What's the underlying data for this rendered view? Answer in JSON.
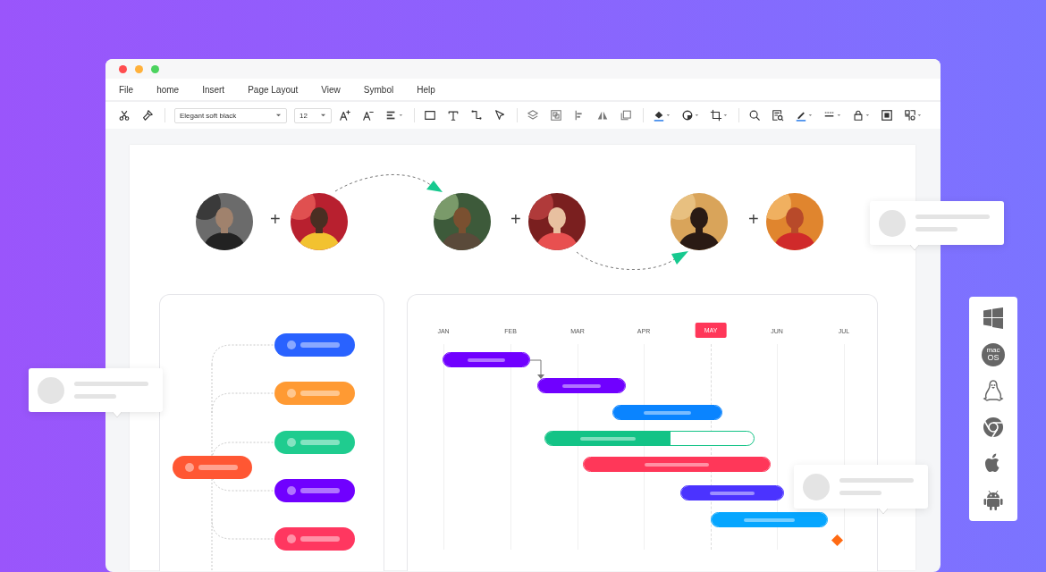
{
  "window": {
    "controls": [
      {
        "kind": "close"
      },
      {
        "kind": "minimize"
      },
      {
        "kind": "maximize"
      }
    ]
  },
  "menu": [
    "File",
    "home",
    "Insert",
    "Page Layout",
    "View",
    "Symbol",
    "Help"
  ],
  "toolbar": {
    "font": "Elegant soft black",
    "size": "12"
  },
  "photo_row": {
    "separators": [
      "+",
      "+",
      "+"
    ]
  },
  "mind_map": {
    "root": {
      "color": "#ff5733"
    },
    "branches": [
      {
        "color": "#2962ff"
      },
      {
        "color": "#ff9a33"
      },
      {
        "color": "#1fcc8f"
      },
      {
        "color": "#7000ff"
      },
      {
        "color": "#ff3760"
      }
    ]
  },
  "gantt": {
    "months": [
      {
        "label": "JAN",
        "selected": false
      },
      {
        "label": "FEB",
        "selected": false
      },
      {
        "label": "MAR",
        "selected": false
      },
      {
        "label": "APR",
        "selected": false
      },
      {
        "label": "MAY",
        "selected": true
      },
      {
        "label": "JUN",
        "selected": false
      },
      {
        "label": "JUL",
        "selected": false
      }
    ],
    "bars": [
      {
        "color": "#7000ff",
        "level": 1
      },
      {
        "color": "#7000ff",
        "level": 1
      },
      {
        "color": "#0a84ff",
        "level": 1
      },
      {
        "color": "#13c386",
        "level": 0.6
      },
      {
        "color": "#ff3759",
        "level": 1
      },
      {
        "color": "#4b33ff",
        "level": 1
      },
      {
        "color": "#06a6ff",
        "level": 1
      }
    ]
  },
  "platforms": [
    {
      "kind": "windows"
    },
    {
      "kind": "macos",
      "top": "mac",
      "label": "OS"
    },
    {
      "kind": "linux"
    },
    {
      "kind": "chrome"
    },
    {
      "kind": "apple"
    },
    {
      "kind": "android"
    }
  ]
}
